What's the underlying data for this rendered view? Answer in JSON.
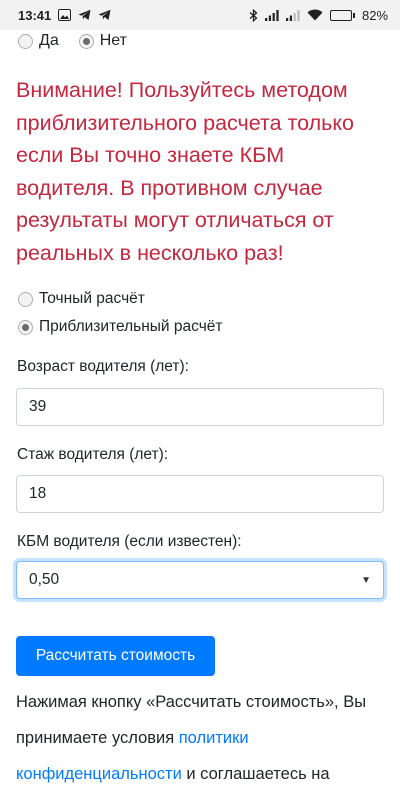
{
  "status_bar": {
    "time": "13:41",
    "battery": "82",
    "battery_level_percent": 82,
    "left_icons": [
      "gallery-icon",
      "telegram-icon",
      "telegram-icon"
    ],
    "right_icons": [
      "bluetooth-icon",
      "signal-icon",
      "signal-icon",
      "wifi-icon",
      "battery-icon"
    ]
  },
  "top_radios": {
    "yes": "Да",
    "no": "Нет",
    "selected": "no"
  },
  "warning": {
    "color": "#c3283f",
    "text": "Внимание! Пользуйтесь методом приблизительного расчета только если Вы точно знаете КБМ водителя. В противном случае результаты могут отличаться от реальных в несколько раз!"
  },
  "calc_mode": {
    "exact": "Точный расчёт",
    "approx": "Приблизительный расчёт",
    "selected": "approx"
  },
  "form": {
    "age_label": "Возраст водителя (лет):",
    "age_value": "39",
    "experience_label": "Стаж водителя (лет):",
    "experience_value": "18",
    "kbm_label": "КБМ водителя (если известен):",
    "kbm_value": "0,50"
  },
  "calculate_button": {
    "label": "Рассчитать стоимость",
    "color": "#007bff"
  },
  "consent": {
    "text_before": "Нажимая кнопку «Рассчитать стоимость», Вы принимаете условия ",
    "link": "политики конфиденциальности",
    "text_after": " и соглашаетесь на обработку персональных данных"
  }
}
